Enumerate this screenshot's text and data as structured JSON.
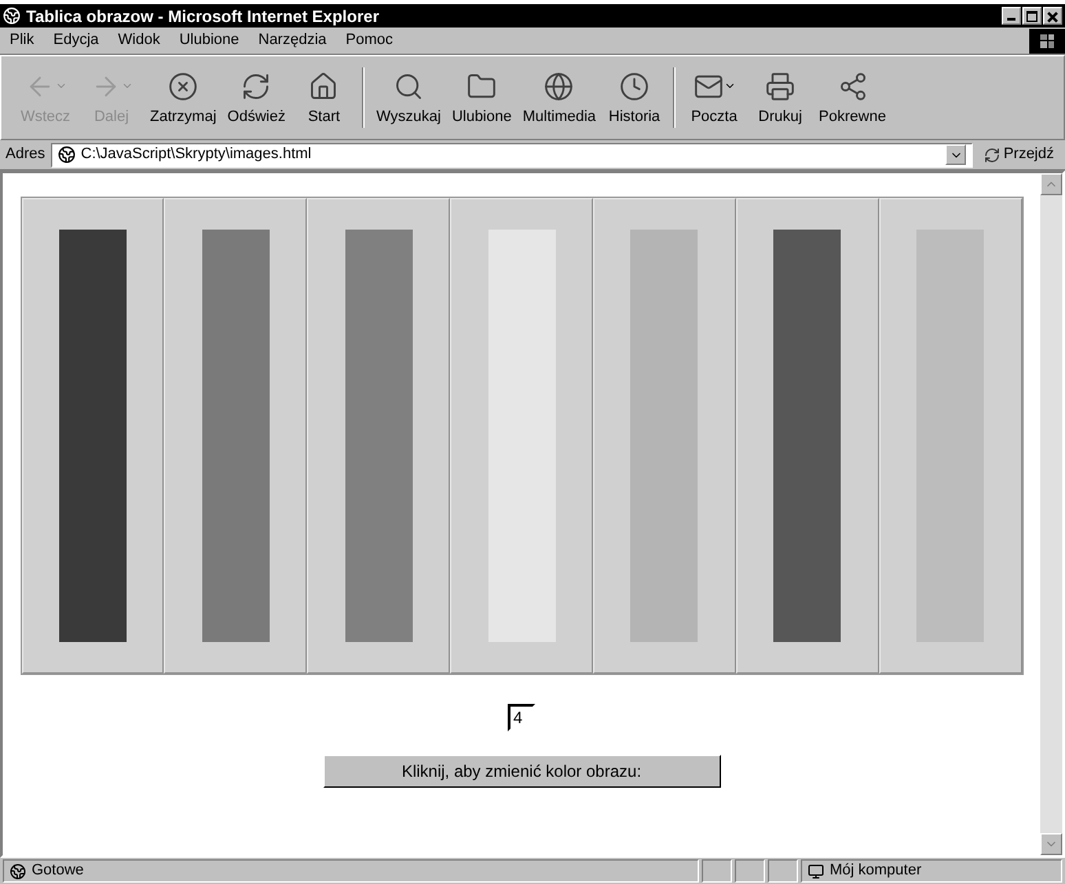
{
  "window": {
    "title": "Tablica obrazow - Microsoft Internet Explorer"
  },
  "menu": [
    "Plik",
    "Edycja",
    "Widok",
    "Ulubione",
    "Narzędzia",
    "Pomoc"
  ],
  "toolbar": [
    {
      "label": "Wstecz",
      "kind": "back",
      "disabled": true,
      "dropdown": true
    },
    {
      "label": "Dalej",
      "kind": "forward",
      "disabled": true,
      "dropdown": true
    },
    {
      "label": "Zatrzymaj",
      "kind": "stop",
      "disabled": false,
      "dropdown": false
    },
    {
      "label": "Odśwież",
      "kind": "refresh",
      "disabled": false,
      "dropdown": false
    },
    {
      "label": "Start",
      "kind": "home",
      "disabled": false,
      "dropdown": false
    },
    {
      "label": "Wyszukaj",
      "kind": "search",
      "disabled": false,
      "dropdown": false
    },
    {
      "label": "Ulubione",
      "kind": "favorites",
      "disabled": false,
      "dropdown": false
    },
    {
      "label": "Multimedia",
      "kind": "media",
      "disabled": false,
      "dropdown": false
    },
    {
      "label": "Historia",
      "kind": "history",
      "disabled": false,
      "dropdown": false
    },
    {
      "label": "Poczta",
      "kind": "mail",
      "disabled": false,
      "dropdown": true
    },
    {
      "label": "Drukuj",
      "kind": "print",
      "disabled": false,
      "dropdown": false
    },
    {
      "label": "Pokrewne",
      "kind": "related",
      "disabled": false,
      "dropdown": false
    }
  ],
  "address": {
    "label": "Adres",
    "value": "C:\\JavaScript\\Skrypty\\images.html",
    "go": "Przejdź"
  },
  "images": [
    {
      "color": "#3a3a3a"
    },
    {
      "color": "#7a7a7a"
    },
    {
      "color": "#808080"
    },
    {
      "color": "#e6e6e6"
    },
    {
      "color": "#b4b4b4"
    },
    {
      "color": "#575757"
    },
    {
      "color": "#bcbcbc"
    }
  ],
  "field": {
    "value": "4"
  },
  "button": {
    "label": "Kliknij, aby zmienić kolor obrazu:"
  },
  "status_bar": {
    "text": "Gotowe",
    "zone": "Mój komputer"
  }
}
